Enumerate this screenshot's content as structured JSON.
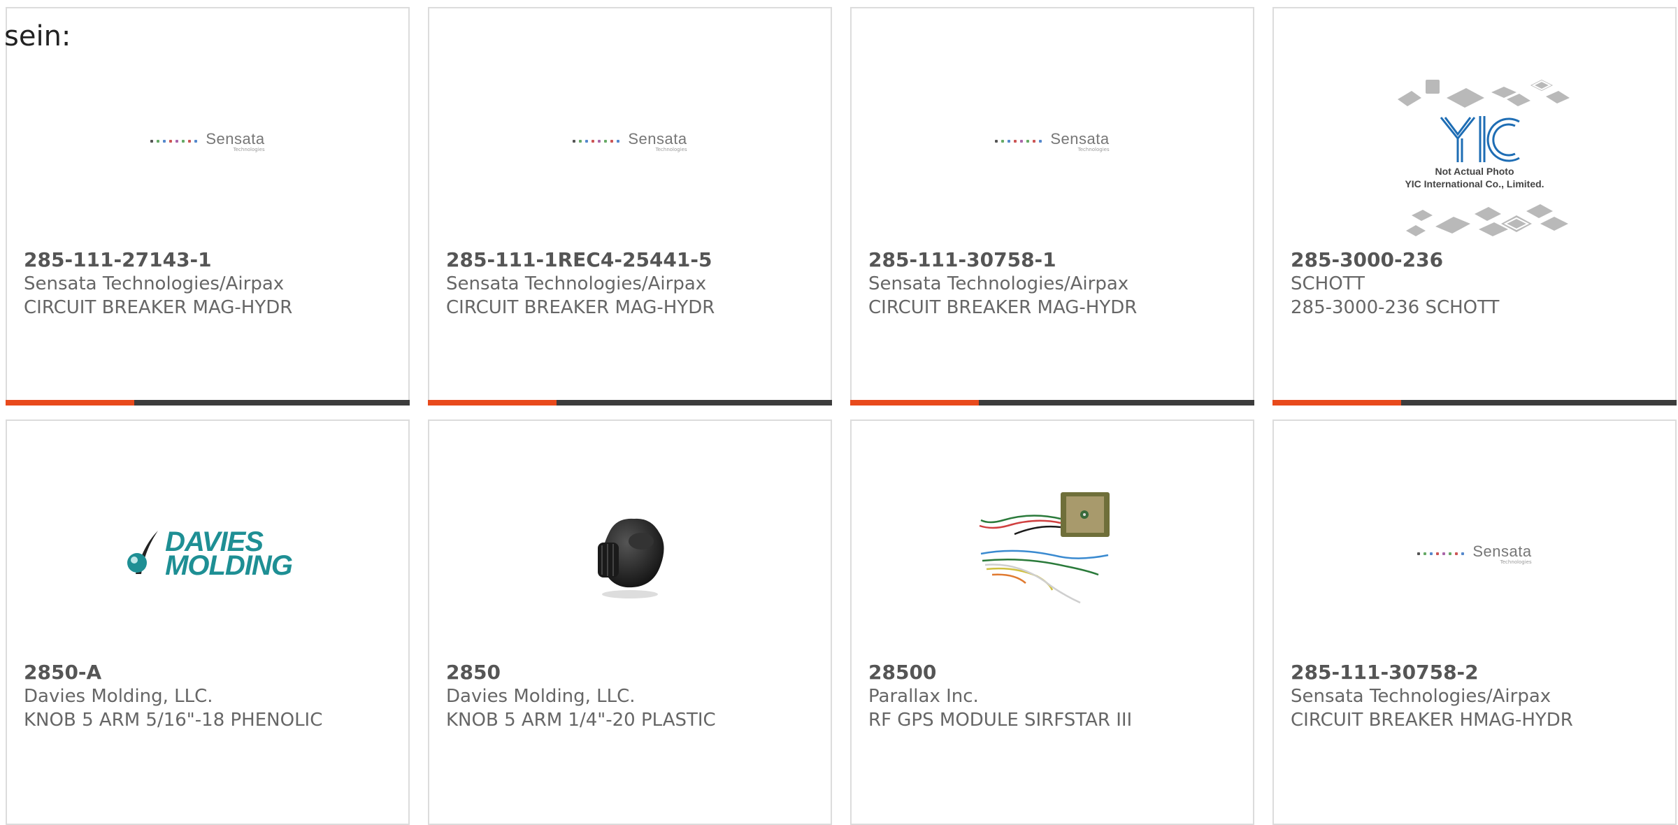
{
  "heading": "sein:",
  "colors": {
    "accent": "#e84a1c",
    "bar": "#3c3c3c",
    "davies": "#1e8f94"
  },
  "products": [
    {
      "part_number": "285-111-27143-1",
      "manufacturer": "Sensata Technologies/Airpax",
      "description": "CIRCUIT BREAKER MAG-HYDR",
      "image": "sensata-logo",
      "logo_name": "Sensata",
      "logo_sub": "Technologies"
    },
    {
      "part_number": "285-111-1REC4-25441-5",
      "manufacturer": "Sensata Technologies/Airpax",
      "description": "CIRCUIT BREAKER MAG-HYDR",
      "image": "sensata-logo",
      "logo_name": "Sensata",
      "logo_sub": "Technologies"
    },
    {
      "part_number": "285-111-30758-1",
      "manufacturer": "Sensata Technologies/Airpax",
      "description": "CIRCUIT BREAKER MAG-HYDR",
      "image": "sensata-logo",
      "logo_name": "Sensata",
      "logo_sub": "Technologies"
    },
    {
      "part_number": "285-3000-236",
      "manufacturer": "SCHOTT",
      "description": "285-3000-236 SCHOTT",
      "image": "yic-placeholder",
      "logo_name": "YIC",
      "logo_line1": "Not Actual Photo",
      "logo_line2": "YIC International Co., Limited."
    },
    {
      "part_number": "2850-A",
      "manufacturer": "Davies Molding, LLC.",
      "description": "KNOB 5 ARM 5/16\"-18 PHENOLIC",
      "image": "davies-logo",
      "logo_line1": "DAVIES",
      "logo_line2": "MOLDING"
    },
    {
      "part_number": "2850",
      "manufacturer": "Davies Molding, LLC.",
      "description": "KNOB 5 ARM 1/4\"-20 PLASTIC",
      "image": "knob-photo"
    },
    {
      "part_number": "28500",
      "manufacturer": "Parallax Inc.",
      "description": "RF GPS MODULE SIRFSTAR III",
      "image": "gps-module-photo"
    },
    {
      "part_number": "285-111-30758-2",
      "manufacturer": "Sensata Technologies/Airpax",
      "description": "CIRCUIT BREAKER HMAG-HYDR",
      "image": "sensata-logo",
      "logo_name": "Sensata",
      "logo_sub": "Technologies"
    }
  ]
}
